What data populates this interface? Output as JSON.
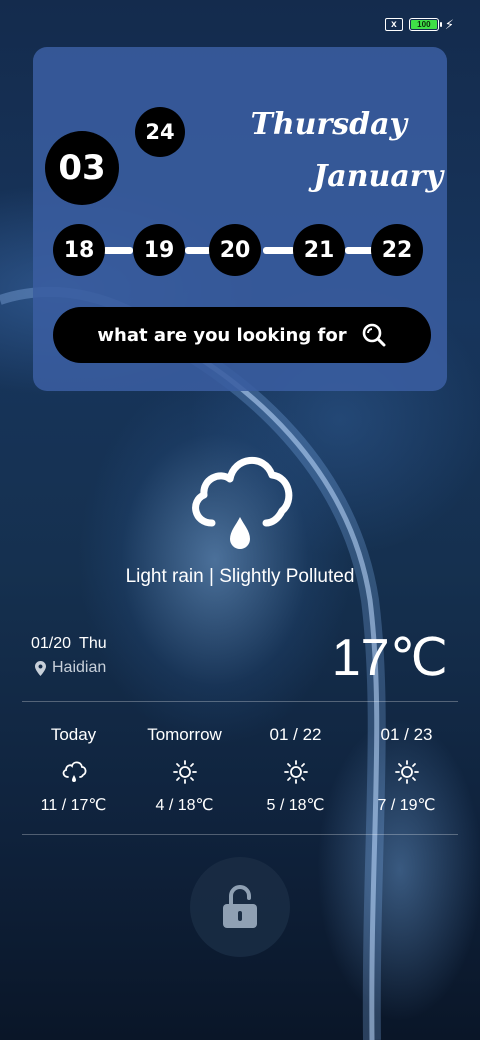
{
  "status_bar": {
    "sim_label": "x",
    "battery_level": "100",
    "battery_fill": 1.0,
    "battery_color": "#3fe047"
  },
  "clock": {
    "hour": "03",
    "minute": "24",
    "weekday": "Thursday",
    "month": "January"
  },
  "calendar": {
    "days": [
      "18",
      "19",
      "20",
      "21",
      "22"
    ]
  },
  "search": {
    "placeholder": "what are you looking for",
    "icon": "search-icon"
  },
  "weather": {
    "icon": "cloud-rain-icon",
    "condition": "Light rain | Slightly Polluted",
    "date": "01/20",
    "weekday": "Thu",
    "location": "Haidian",
    "temperature": "17℃"
  },
  "forecast": [
    {
      "label": "Today",
      "icon": "cloud-rain-icon",
      "range": "11 / 17℃"
    },
    {
      "label": "Tomorrow",
      "icon": "sun-icon",
      "range": "4 / 18℃"
    },
    {
      "label": "01 / 22",
      "icon": "sun-icon",
      "range": "5 / 18℃"
    },
    {
      "label": "01 / 23",
      "icon": "sun-icon",
      "range": "7 / 19℃"
    }
  ],
  "unlock": {
    "icon": "unlock-icon"
  },
  "colors": {
    "card": "#3a5da0",
    "accent_green": "#3fe047"
  }
}
